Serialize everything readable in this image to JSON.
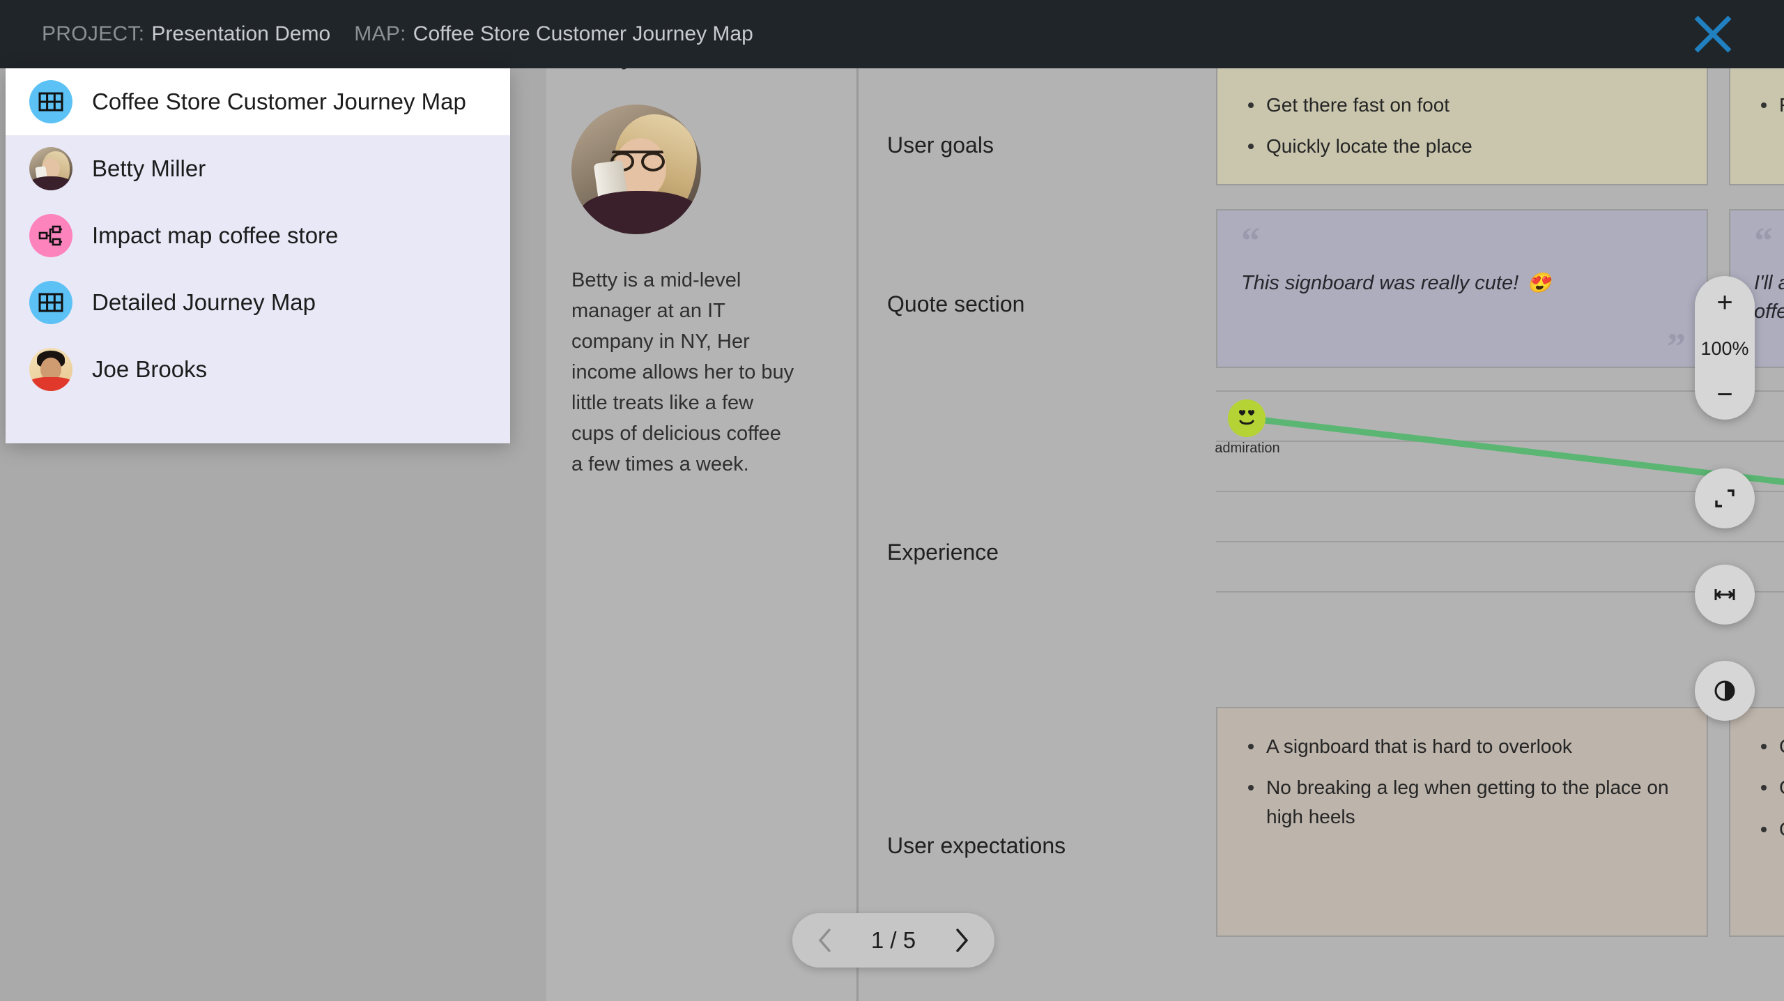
{
  "header": {
    "project_key": "PROJECT:",
    "project_value": "Presentation Demo",
    "map_key": "MAP:",
    "map_value": "Coffee Store Customer Journey Map",
    "close_icon": "close-icon",
    "bar_color": "#20252a",
    "close_color": "#2080c0"
  },
  "panel": {
    "items": [
      {
        "label": "Coffee Store Customer Journey Map",
        "icon": "grid-table-icon",
        "icon_color": "#5cc2f5",
        "active": true
      },
      {
        "label": "Betty Miller",
        "icon": "avatar-photo-betty",
        "icon_color": "",
        "active": false
      },
      {
        "label": "Impact map coffee store",
        "icon": "impact-map-icon",
        "icon_color": "#fd83bd",
        "active": false
      },
      {
        "label": "Detailed Journey Map",
        "icon": "grid-table-icon",
        "icon_color": "#5cc2f5",
        "active": false
      },
      {
        "label": "Joe Brooks",
        "icon": "avatar-photo-joe",
        "icon_color": "",
        "active": false
      }
    ]
  },
  "persona": {
    "name": "Betty Miller",
    "bio": "Betty is a mid-level manager at an IT company in NY, Her income allows her to buy little treats like a few cups of delicious coffee a few times a week."
  },
  "rows": [
    {
      "label": "User goals"
    },
    {
      "label": "Quote section"
    },
    {
      "label": "Experience"
    },
    {
      "label": "User expectations"
    }
  ],
  "cells": {
    "goals_col1": [
      "Get there fast on foot",
      "Quickly locate the place"
    ],
    "goals_col2": [
      "Fin"
    ],
    "quote_col1": {
      "open_mark": "“",
      "close_mark": "”",
      "text": "This signboard was really cute!",
      "emoji": "😍"
    },
    "quote_col2": {
      "open_mark": "“",
      "text_line1": "I'll as",
      "text_line2": "offe"
    },
    "expect_col1": [
      "A signboard that is hard to overlook",
      "No breaking a leg when getting to the place on high heels"
    ],
    "expect_col2": [
      "Co",
      "Go",
      "Go"
    ]
  },
  "experience": {
    "node_label": "admiration",
    "node_color": "#b5d334",
    "line_color": "#5ab672",
    "emoji_icon": "heart-eyes-smiley-icon"
  },
  "controls": {
    "zoom_in": "+",
    "zoom_level": "100%",
    "zoom_out": "−",
    "fit_screen_icon": "fit-to-screen-icon",
    "fit_width_icon": "fit-width-icon",
    "contrast_icon": "contrast-icon"
  },
  "pager": {
    "prev_icon": "chevron-left-icon",
    "count": "1 / 5",
    "next_icon": "chevron-right-icon"
  }
}
